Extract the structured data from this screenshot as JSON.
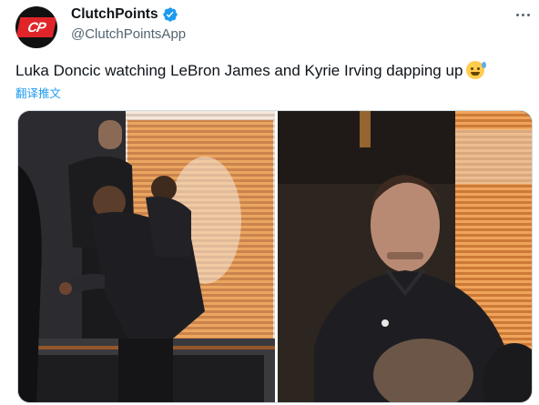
{
  "tweet": {
    "author": {
      "display_name": "ClutchPoints",
      "handle": "@ClutchPointsApp",
      "avatar_text": "CP",
      "verified": true
    },
    "text": "Luka Doncic watching LeBron James and Kyrie Irving dapping up",
    "emoji": "sweat-smile-emoji",
    "translate_label": "翻译推文"
  },
  "media": {
    "images": [
      {
        "name": "left-photo"
      },
      {
        "name": "right-photo"
      }
    ]
  },
  "colors": {
    "link": "#1d9bf0",
    "secondary_text": "#536471",
    "brand_red": "#e0252a",
    "border": "#cfd9de"
  }
}
